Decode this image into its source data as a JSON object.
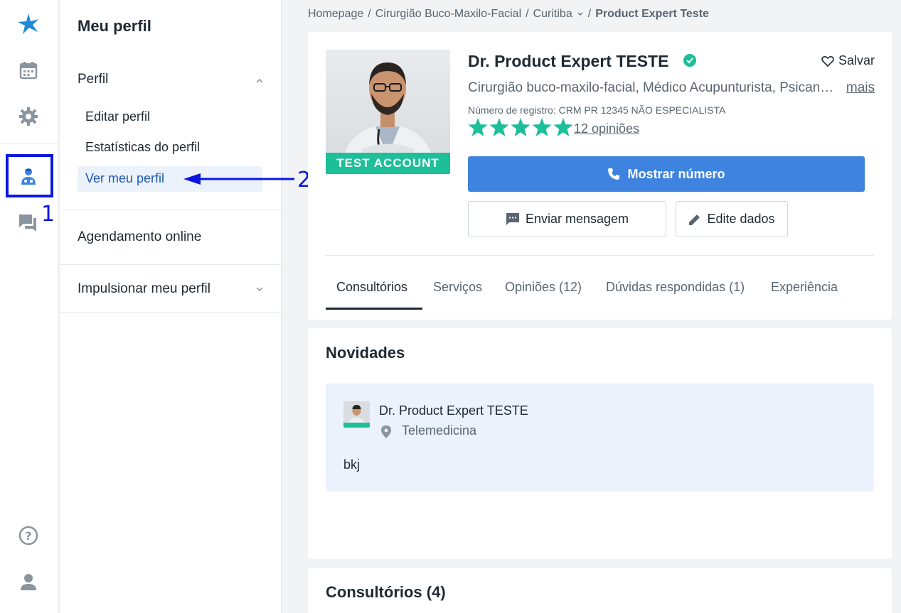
{
  "rail": {
    "icons": [
      "brand-logo-icon",
      "calendar-icon",
      "gear-icon",
      "doctor-profile-icon",
      "chat-icon",
      "help-icon",
      "user-icon"
    ]
  },
  "annotations": {
    "marker_1": "1",
    "marker_2": "2",
    "color": "#0a17e0"
  },
  "menu": {
    "title": "Meu perfil",
    "section_perfil": "Perfil",
    "items": [
      "Editar perfil",
      "Estatísticas do perfil",
      "Ver meu perfil"
    ],
    "section_agendamento": "Agendamento online",
    "section_impulsionar": "Impulsionar meu perfil"
  },
  "breadcrumb": {
    "items": [
      "Homepage",
      "Cirurgião Buco-Maxilo-Facial",
      "Curitiba",
      "Product Expert Teste"
    ]
  },
  "profile": {
    "name": "Dr. Product Expert TESTE",
    "save_label": "Salvar",
    "specialties": "Cirurgião buco-maxilo-facial, Médico Acupunturista, Psicanalista",
    "more_label": "mais",
    "registration": "Número de registro: CRM PR 12345 NÃO ESPECIALISTA",
    "rating": 5,
    "opinions_label": "12 opiniões",
    "badge": "TEST ACCOUNT",
    "show_number_label": "Mostrar número",
    "send_message_label": "Enviar mensagem",
    "edit_data_label": "Edite dados",
    "tabs": [
      "Consultórios",
      "Serviços",
      "Opiniões (12)",
      "Dúvidas respondidas (1)",
      "Experiência"
    ],
    "active_tab": "Consultórios"
  },
  "news": {
    "title": "Novidades",
    "author": "Dr. Product Expert TESTE",
    "location": "Telemedicina",
    "text": "bkj"
  },
  "offices": {
    "title": "Consultórios (4)"
  },
  "colors": {
    "primary": "#3d83df",
    "accent": "#1dbf98",
    "active_bg": "#ebf2fb",
    "annotation": "#0a17e0"
  }
}
